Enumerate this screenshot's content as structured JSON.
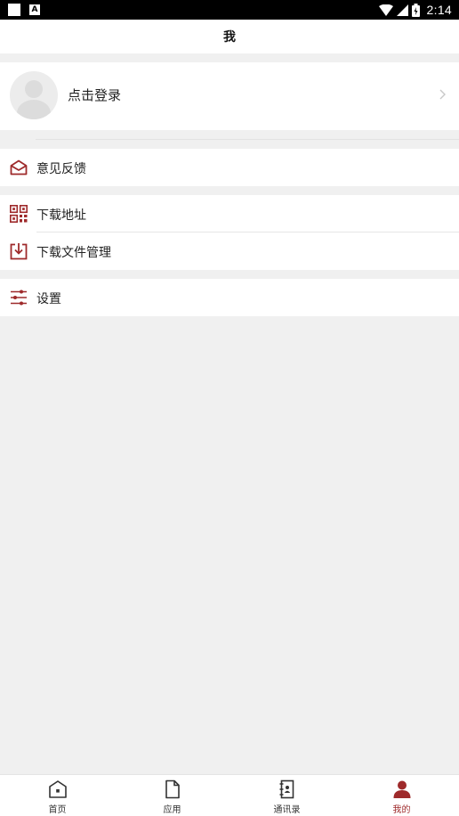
{
  "status_bar": {
    "time": "2:14",
    "notification_letter": "A"
  },
  "header": {
    "title": "我"
  },
  "profile": {
    "login_label": "点击登录"
  },
  "menu": {
    "feedback": "意见反馈",
    "download_address": "下载地址",
    "download_manager": "下载文件管理",
    "settings": "设置"
  },
  "bottom_nav": {
    "items": [
      {
        "label": "首页",
        "icon": "home-icon"
      },
      {
        "label": "应用",
        "icon": "document-icon"
      },
      {
        "label": "通讯录",
        "icon": "contacts-icon"
      },
      {
        "label": "我的",
        "icon": "person-icon",
        "active": true
      }
    ]
  },
  "colors": {
    "accent": "#9e2a2b",
    "background": "#f0f0f0"
  }
}
